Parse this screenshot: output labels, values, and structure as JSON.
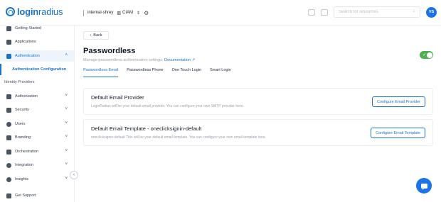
{
  "brand": {
    "name_bold": "login",
    "name_rest": "radius"
  },
  "topbar": {
    "app_name": "internal-shrey",
    "env_label": "CIAM",
    "env_chevron": "⇕",
    "settings_icon": "gear-icon",
    "search_placeholder": "Search for resources",
    "avatar_initials": "VS"
  },
  "sidebar": {
    "items": [
      {
        "label": "Getting Started",
        "icon": "rocket-icon"
      },
      {
        "label": "Applications",
        "icon": "layers-icon"
      },
      {
        "label": "Authentication",
        "icon": "lock-icon"
      },
      {
        "label": "Authorization",
        "icon": "key-icon"
      },
      {
        "label": "Security",
        "icon": "shield-icon"
      },
      {
        "label": "Users",
        "icon": "user-icon"
      },
      {
        "label": "Branding",
        "icon": "brush-icon"
      },
      {
        "label": "Orchestration",
        "icon": "flow-icon"
      },
      {
        "label": "Integration",
        "icon": "plug-icon"
      },
      {
        "label": "Insights",
        "icon": "chart-icon"
      },
      {
        "label": "Get Support",
        "icon": "support-icon"
      }
    ],
    "sub_items": [
      {
        "label": "Authentication Configuration"
      },
      {
        "label": "Identity Providers"
      }
    ]
  },
  "page": {
    "back_label": "Back",
    "title": "Passwordless",
    "subtitle": "Manage passwordless authentication settings.",
    "doc_link": "Documentation",
    "enabled": true,
    "tabs": [
      {
        "label": "Passwordless Email",
        "active": true
      },
      {
        "label": "Passwordless Phone",
        "active": false
      },
      {
        "label": "One Touch Login",
        "active": false
      },
      {
        "label": "Smart Login",
        "active": false
      }
    ],
    "panels": [
      {
        "title": "Default Email Provider",
        "description": "LoginRadius will be your default email provider. You can configure your own SMTP provider here.",
        "button": "Configure Email Provider"
      },
      {
        "title": "Default Email Template - oneclicksignin-default",
        "description": "oneclicksignin-default This will be your default email template. You can configure your own email template here.",
        "button": "Configure Email Template"
      }
    ]
  },
  "colors": {
    "accent": "#1a73c9",
    "toggle_on": "#4caf50",
    "avatar_bg": "#1a73e8"
  }
}
